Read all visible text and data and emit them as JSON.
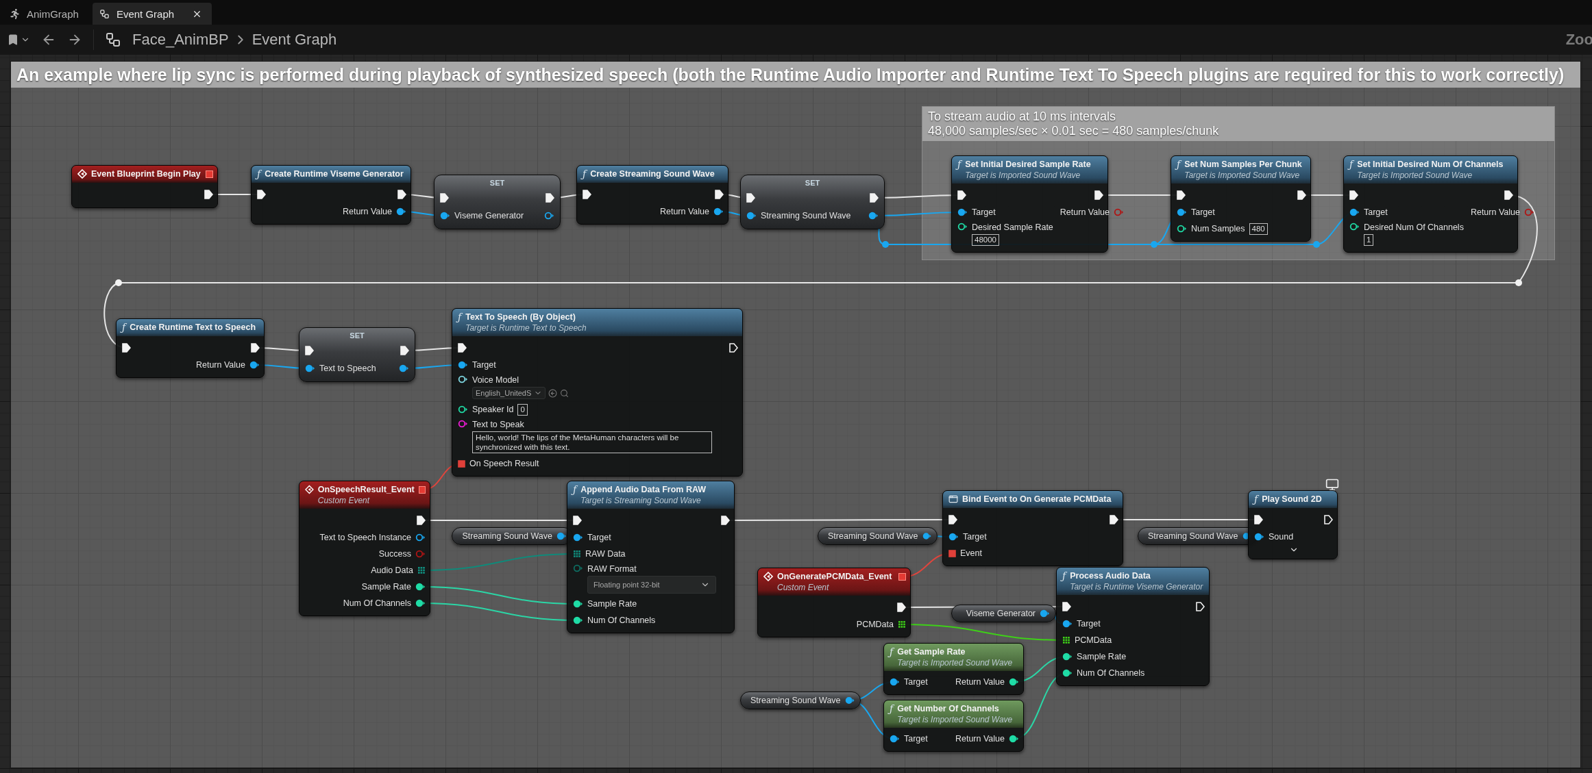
{
  "tabs": [
    {
      "label": "AnimGraph",
      "selected": false
    },
    {
      "label": "Event Graph",
      "selected": true
    }
  ],
  "breadcrumb": {
    "items": [
      "Face_AnimBP",
      "Event Graph"
    ]
  },
  "zoom_label": "Zoo",
  "comments": [
    {
      "lines": [
        "An example where lip sync is performed during playback of synthesized speech (both the Runtime Audio Importer and Runtime Text To Speech plugins are required for this to work correctly)"
      ]
    },
    {
      "lines": [
        "To stream audio at 10 ms intervals",
        "48,000 samples/sec × 0.01 sec = 480 samples/chunk"
      ]
    }
  ],
  "nodes": [
    {
      "kind": "event",
      "title": "Event Blueprint Begin Play",
      "exec_out": {
        "connected": true
      }
    },
    {
      "kind": "function",
      "glyph": "ƒ",
      "title": "Create Runtime Viseme Generator",
      "exec_in": {
        "connected": true
      },
      "exec_out": {
        "connected": true
      },
      "outputs": [
        {
          "label": "Return Value",
          "kind": "object",
          "connected": true
        }
      ]
    },
    {
      "kind": "set",
      "title": "SET",
      "exec_in": {
        "connected": true
      },
      "exec_out": {
        "connected": true
      },
      "inputs": [
        {
          "label": "Viseme Generator",
          "kind": "object",
          "connected": true
        }
      ],
      "outputs": [
        {
          "kind": "object",
          "connected": false
        }
      ]
    },
    {
      "kind": "function",
      "glyph": "ƒ",
      "title": "Create Streaming Sound Wave",
      "exec_in": {
        "connected": true
      },
      "exec_out": {
        "connected": true
      },
      "outputs": [
        {
          "label": "Return Value",
          "kind": "object",
          "connected": true
        }
      ]
    },
    {
      "kind": "set",
      "title": "SET",
      "exec_in": {
        "connected": true
      },
      "exec_out": {
        "connected": true
      },
      "inputs": [
        {
          "label": "Streaming Sound Wave",
          "kind": "object",
          "connected": true
        }
      ],
      "outputs": [
        {
          "kind": "object",
          "connected": true
        }
      ]
    },
    {
      "kind": "function",
      "glyph": "ƒ",
      "title": "Set Initial Desired Sample Rate",
      "subtitle": "Target is Imported Sound Wave",
      "exec_in": {
        "connected": true
      },
      "exec_out": {
        "connected": true
      },
      "inputs": [
        {
          "label": "Target",
          "kind": "object",
          "connected": true
        },
        {
          "label": "Desired Sample Rate",
          "kind": "int",
          "connected": false,
          "editor": {
            "kind": "number",
            "value": "48000"
          }
        }
      ],
      "outputs": [
        {
          "label": "Return Value",
          "kind": "bool",
          "connected": false
        }
      ]
    },
    {
      "kind": "function",
      "glyph": "ƒ",
      "title": "Set Num Samples Per Chunk",
      "subtitle": "Target is Imported Sound Wave",
      "exec_in": {
        "connected": true
      },
      "exec_out": {
        "connected": true
      },
      "inputs": [
        {
          "label": "Target",
          "kind": "object",
          "connected": true
        },
        {
          "label": "Num Samples",
          "kind": "int",
          "connected": false,
          "editor": {
            "kind": "number",
            "value": "480"
          }
        }
      ]
    },
    {
      "kind": "function",
      "glyph": "ƒ",
      "title": "Set Initial Desired Num Of Channels",
      "subtitle": "Target is Imported Sound Wave",
      "exec_in": {
        "connected": true
      },
      "exec_out": {
        "connected": true
      },
      "inputs": [
        {
          "label": "Target",
          "kind": "object",
          "connected": true
        },
        {
          "label": "Desired Num Of Channels",
          "kind": "int",
          "connected": false,
          "editor": {
            "kind": "number",
            "value": "1"
          }
        }
      ],
      "outputs": [
        {
          "label": "Return Value",
          "kind": "bool",
          "connected": false
        }
      ]
    },
    {
      "kind": "function",
      "glyph": "ƒ",
      "title": "Create Runtime Text to Speech",
      "exec_in": {
        "connected": true
      },
      "exec_out": {
        "connected": true
      },
      "outputs": [
        {
          "label": "Return Value",
          "kind": "object",
          "connected": true
        }
      ]
    },
    {
      "kind": "set",
      "title": "SET",
      "exec_in": {
        "connected": true
      },
      "exec_out": {
        "connected": true
      },
      "inputs": [
        {
          "label": "Text to Speech",
          "kind": "object",
          "connected": true
        }
      ],
      "outputs": [
        {
          "kind": "object",
          "connected": true
        }
      ]
    },
    {
      "kind": "function",
      "glyph": "ƒ",
      "title": "Text To Speech (By Object)",
      "subtitle": "Target is Runtime Text to Speech",
      "exec_in": {
        "connected": true
      },
      "exec_out": {
        "connected": false
      },
      "inputs": [
        {
          "label": "Target",
          "kind": "object",
          "connected": true
        },
        {
          "label": "Voice Model",
          "kind": "class",
          "connected": false,
          "editor": {
            "kind": "asset",
            "value": "English_UnitedS"
          }
        },
        {
          "label": "Speaker Id",
          "kind": "int",
          "connected": false,
          "editor": {
            "kind": "number",
            "value": "0"
          }
        },
        {
          "label": "Text to Speak",
          "kind": "string",
          "connected": false,
          "editor": {
            "kind": "text",
            "value": "Hello, world! The lips of the MetaHuman characters will be synchronized with this text."
          }
        },
        {
          "label": "On Speech Result",
          "kind": "delegate",
          "connected": true
        }
      ]
    },
    {
      "kind": "event",
      "title": "OnSpeechResult_Event",
      "subtitle": "Custom Event",
      "exec_out": {
        "connected": true
      },
      "outputs": [
        {
          "label": "Text to Speech Instance",
          "kind": "object",
          "connected": false
        },
        {
          "label": "Success",
          "kind": "bool",
          "connected": false
        },
        {
          "label": "Audio Data",
          "kind": "byte_array",
          "connected": true
        },
        {
          "label": "Sample Rate",
          "kind": "int",
          "connected": true
        },
        {
          "label": "Num Of Channels",
          "kind": "int",
          "connected": true
        }
      ]
    },
    {
      "kind": "getter",
      "outputs": [
        {
          "label": "Streaming Sound Wave",
          "kind": "object",
          "connected": true
        }
      ]
    },
    {
      "kind": "function",
      "glyph": "ƒ",
      "title": "Append Audio Data From RAW",
      "subtitle": "Target is Streaming Sound Wave",
      "exec_in": {
        "connected": true
      },
      "exec_out": {
        "connected": true
      },
      "inputs": [
        {
          "label": "Target",
          "kind": "object",
          "connected": true
        },
        {
          "label": "RAW Data",
          "kind": "byte_array",
          "connected": true
        },
        {
          "label": "RAW Format",
          "kind": "enum",
          "connected": false,
          "editor": {
            "kind": "dropdown",
            "value": "Floating point 32-bit"
          }
        },
        {
          "label": "Sample Rate",
          "kind": "int",
          "connected": true
        },
        {
          "label": "Num Of Channels",
          "kind": "int",
          "connected": true
        }
      ]
    },
    {
      "kind": "getter",
      "outputs": [
        {
          "label": "Streaming Sound Wave",
          "kind": "object",
          "connected": true
        }
      ]
    },
    {
      "kind": "bind",
      "title": "Bind Event to On Generate PCMData",
      "exec_in": {
        "connected": true
      },
      "exec_out": {
        "connected": true
      },
      "inputs": [
        {
          "label": "Target",
          "kind": "object",
          "connected": true
        },
        {
          "label": "Event",
          "kind": "delegate",
          "connected": true
        }
      ]
    },
    {
      "kind": "getter",
      "outputs": [
        {
          "label": "Streaming Sound Wave",
          "kind": "object",
          "connected": true
        }
      ]
    },
    {
      "kind": "function",
      "glyph": "ƒ",
      "title": "Play Sound 2D",
      "exec_in": {
        "connected": true
      },
      "exec_out": {
        "connected": false
      },
      "client_only": true,
      "advanced": true,
      "inputs": [
        {
          "label": "Sound",
          "kind": "object",
          "connected": true
        }
      ]
    },
    {
      "kind": "event",
      "title": "OnGeneratePCMData_Event",
      "subtitle": "Custom Event",
      "exec_out": {
        "connected": true
      },
      "outputs": [
        {
          "label": "PCMData",
          "kind": "float_array",
          "connected": true
        }
      ]
    },
    {
      "kind": "getter",
      "outputs": [
        {
          "label": "Viseme Generator",
          "kind": "object",
          "connected": true
        }
      ]
    },
    {
      "kind": "function",
      "glyph": "ƒ",
      "title": "Process Audio Data",
      "subtitle": "Target is Runtime Viseme Generator",
      "exec_in": {
        "connected": true
      },
      "exec_out": {
        "connected": false
      },
      "inputs": [
        {
          "label": "Target",
          "kind": "object",
          "connected": true
        },
        {
          "label": "PCMData",
          "kind": "float_array",
          "connected": true
        },
        {
          "label": "Sample Rate",
          "kind": "int",
          "connected": true
        },
        {
          "label": "Num Of Channels",
          "kind": "int",
          "connected": true
        }
      ]
    },
    {
      "kind": "pure",
      "glyph": "ƒ",
      "title": "Get Sample Rate",
      "subtitle": "Target is Imported Sound Wave",
      "inputs": [
        {
          "label": "Target",
          "kind": "object",
          "connected": true
        }
      ],
      "outputs": [
        {
          "label": "Return Value",
          "kind": "int",
          "connected": true
        }
      ]
    },
    {
      "kind": "pure",
      "glyph": "ƒ",
      "title": "Get Number Of Channels",
      "subtitle": "Target is Imported Sound Wave",
      "inputs": [
        {
          "label": "Target",
          "kind": "object",
          "connected": true
        }
      ],
      "outputs": [
        {
          "label": "Return Value",
          "kind": "int",
          "connected": true
        }
      ]
    },
    {
      "kind": "getter",
      "outputs": [
        {
          "label": "Streaming Sound Wave",
          "kind": "object",
          "connected": true
        }
      ]
    }
  ]
}
